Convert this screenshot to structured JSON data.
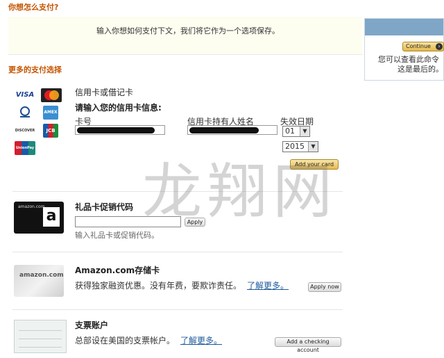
{
  "header": {
    "section_title": "你想怎么支付?",
    "intro_text": "输入你想如何支付下文，我们将它作为一个选项保存。"
  },
  "side_panel": {
    "continue_label": "Continue",
    "text_line1": "您可以查看此命令",
    "text_line2": "这是最后的。"
  },
  "more_payment_title": "更多的支付选择",
  "card_logos": [
    {
      "icon": "visa-logo",
      "text": "VISA"
    },
    {
      "icon": "mastercard-logo",
      "text": "Master"
    },
    {
      "icon": "diners-logo",
      "text": "Diners"
    },
    {
      "icon": "amex-logo",
      "text": "AMEX"
    },
    {
      "icon": "discover-logo",
      "text": "DISCOVER"
    },
    {
      "icon": "jcb-logo",
      "text": "JCB"
    },
    {
      "icon": "unionpay-logo",
      "text": "UnionPay"
    }
  ],
  "credit_card": {
    "title": "信用卡或借记卡",
    "prompt": "请输入您的信用卡信息:",
    "card_number_label": "卡号",
    "cardholder_label": "信用卡持有人姓名",
    "expiry_label": "失效日期",
    "month_value": "01",
    "year_value": "2015",
    "add_button": "Add your card"
  },
  "gift_card": {
    "title": "礼品卡促销代码",
    "card_brand": "amazon.com",
    "card_glyph": "a",
    "apply_button": "Apply",
    "hint": "输入礼品卡或促销代码。"
  },
  "store_card": {
    "title": "Amazon.com存储卡",
    "card_brand": "amazon.com",
    "description": "获得独家融资优惠。没有年费，要欺诈责任。",
    "learn_more": "了解更多。",
    "apply_button": "Apply now"
  },
  "checking": {
    "title": "支票账户",
    "description": "总部设在美国的支票帐户。",
    "learn_more": "了解更多。",
    "add_button": "Add a checking account"
  },
  "watermark": "龙翔网",
  "colors": {
    "section_title": "#c45500",
    "link": "#1d5b9c",
    "button_gold": "#e7ba4d",
    "side_bar": "#7fa6c7"
  }
}
